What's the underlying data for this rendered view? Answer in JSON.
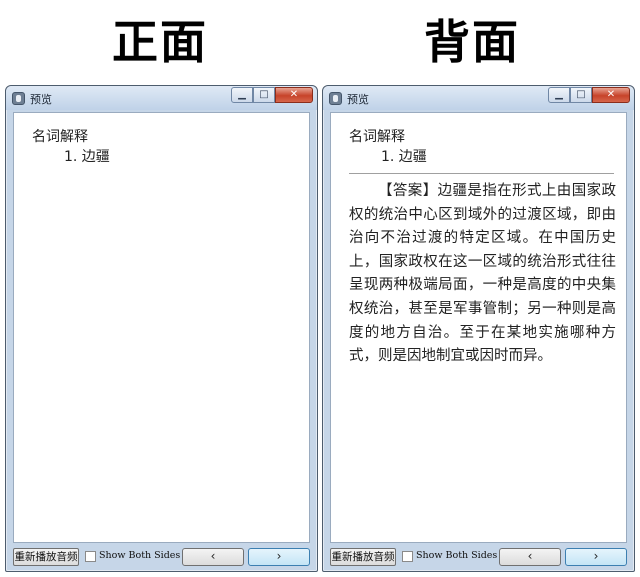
{
  "headings": {
    "front": "正面",
    "back": "背面"
  },
  "window": {
    "title": "预览",
    "minimize_glyph": "▁",
    "maximize_glyph": "□",
    "close_glyph": "✕",
    "replay_label": "重新播放音频",
    "show_both_sides_label": "Show Both Sides",
    "show_both_sides_checked": false,
    "prev_glyph": "‹",
    "next_glyph": "›"
  },
  "card": {
    "question_type": "名词解释",
    "question_item": "1. 边疆",
    "answer": "【答案】边疆是指在形式上由国家政权的统治中心区到域外的过渡区域，即由治向不治过渡的特定区域。在中国历史上，国家政权在这一区域的统治形式往往呈现两种极端局面，一种是高度的中央集权统治，甚至是军事管制；另一种则是高度的地方自治。至于在某地实施哪种方式，则是因地制宜或因时而异。"
  },
  "icons": [
    "app-icon",
    "minimize-icon",
    "maximize-icon",
    "close-icon",
    "checkbox-icon",
    "chevron-left-icon",
    "chevron-right-icon"
  ]
}
